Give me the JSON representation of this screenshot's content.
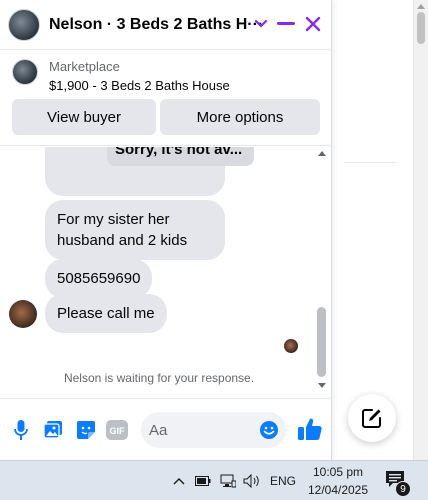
{
  "header": {
    "title": "Nelson · 3 Beds 2 Baths H···"
  },
  "marketplace": {
    "label": "Marketplace",
    "item": "$1,900 - 3 Beds 2 Baths House",
    "view_buyer": "View buyer",
    "more_options": "More options"
  },
  "messages": {
    "quote": "Sorry, it's not av...",
    "items": [
      "For my sister her husband and 2 kids",
      "5085659690",
      "Please call me"
    ],
    "waiting": "Nelson is waiting for your response."
  },
  "composer": {
    "placeholder": "Aa",
    "gif_label": "GIF"
  },
  "taskbar": {
    "lang": "ENG",
    "time": "10:05 pm",
    "date": "12/04/2025",
    "notification_count": "9"
  },
  "colors": {
    "accent": "#8a2be2",
    "messenger_blue": "#0a7cff",
    "bubble": "#e4e6eb"
  }
}
